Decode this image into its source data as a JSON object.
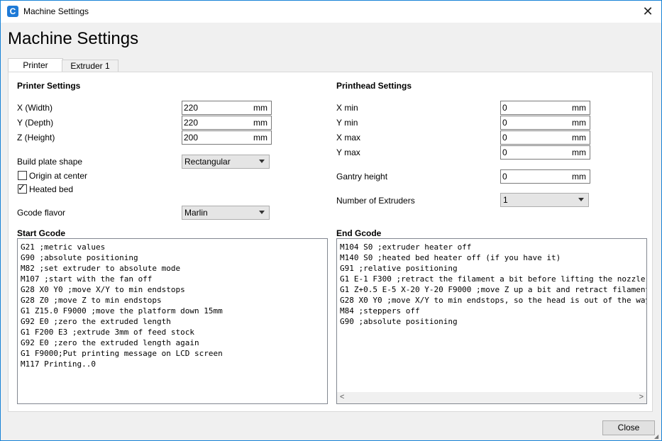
{
  "window": {
    "title": "Machine Settings",
    "heading": "Machine Settings",
    "close_label": "Close"
  },
  "tabs": [
    {
      "label": "Printer",
      "active": true
    },
    {
      "label": "Extruder 1",
      "active": false
    }
  ],
  "printer_settings": {
    "heading": "Printer Settings",
    "x_label": "X (Width)",
    "x_value": "220",
    "x_unit": "mm",
    "y_label": "Y (Depth)",
    "y_value": "220",
    "y_unit": "mm",
    "z_label": "Z (Height)",
    "z_value": "200",
    "z_unit": "mm",
    "build_plate_label": "Build plate shape",
    "build_plate_value": "Rectangular",
    "origin_label": "Origin at center",
    "origin_checked": false,
    "heated_bed_label": "Heated bed",
    "heated_bed_checked": true,
    "gcode_flavor_label": "Gcode flavor",
    "gcode_flavor_value": "Marlin"
  },
  "printhead_settings": {
    "heading": "Printhead Settings",
    "xmin_label": "X min",
    "xmin_value": "0",
    "xmin_unit": "mm",
    "ymin_label": "Y min",
    "ymin_value": "0",
    "ymin_unit": "mm",
    "xmax_label": "X max",
    "xmax_value": "0",
    "xmax_unit": "mm",
    "ymax_label": "Y max",
    "ymax_value": "0",
    "ymax_unit": "mm",
    "gantry_label": "Gantry height",
    "gantry_value": "0",
    "gantry_unit": "mm",
    "extruders_label": "Number of Extruders",
    "extruders_value": "1"
  },
  "start_gcode": {
    "heading": "Start Gcode",
    "text": "G21 ;metric values\nG90 ;absolute positioning\nM82 ;set extruder to absolute mode\nM107 ;start with the fan off\nG28 X0 Y0 ;move X/Y to min endstops\nG28 Z0 ;move Z to min endstops\nG1 Z15.0 F9000 ;move the platform down 15mm\nG92 E0 ;zero the extruded length\nG1 F200 E3 ;extrude 3mm of feed stock\nG92 E0 ;zero the extruded length again\nG1 F9000;Put printing message on LCD screen\nM117 Printing..0"
  },
  "end_gcode": {
    "heading": "End Gcode",
    "text": "M104 S0 ;extruder heater off\nM140 S0 ;heated bed heater off (if you have it)\nG91 ;relative positioning\nG1 E-1 F300 ;retract the filament a bit before lifting the nozzle\nG1 Z+0.5 E-5 X-20 Y-20 F9000 ;move Z up a bit and retract filament even more\nG28 X0 Y0 ;move X/Y to min endstops, so the head is out of the way\nM84 ;steppers off\nG90 ;absolute positioning"
  },
  "colors": {
    "accent": "#1883d7",
    "app_icon": "#1e7ad7"
  },
  "icons": {
    "app": "cura-logo-icon",
    "close": "close-icon"
  }
}
